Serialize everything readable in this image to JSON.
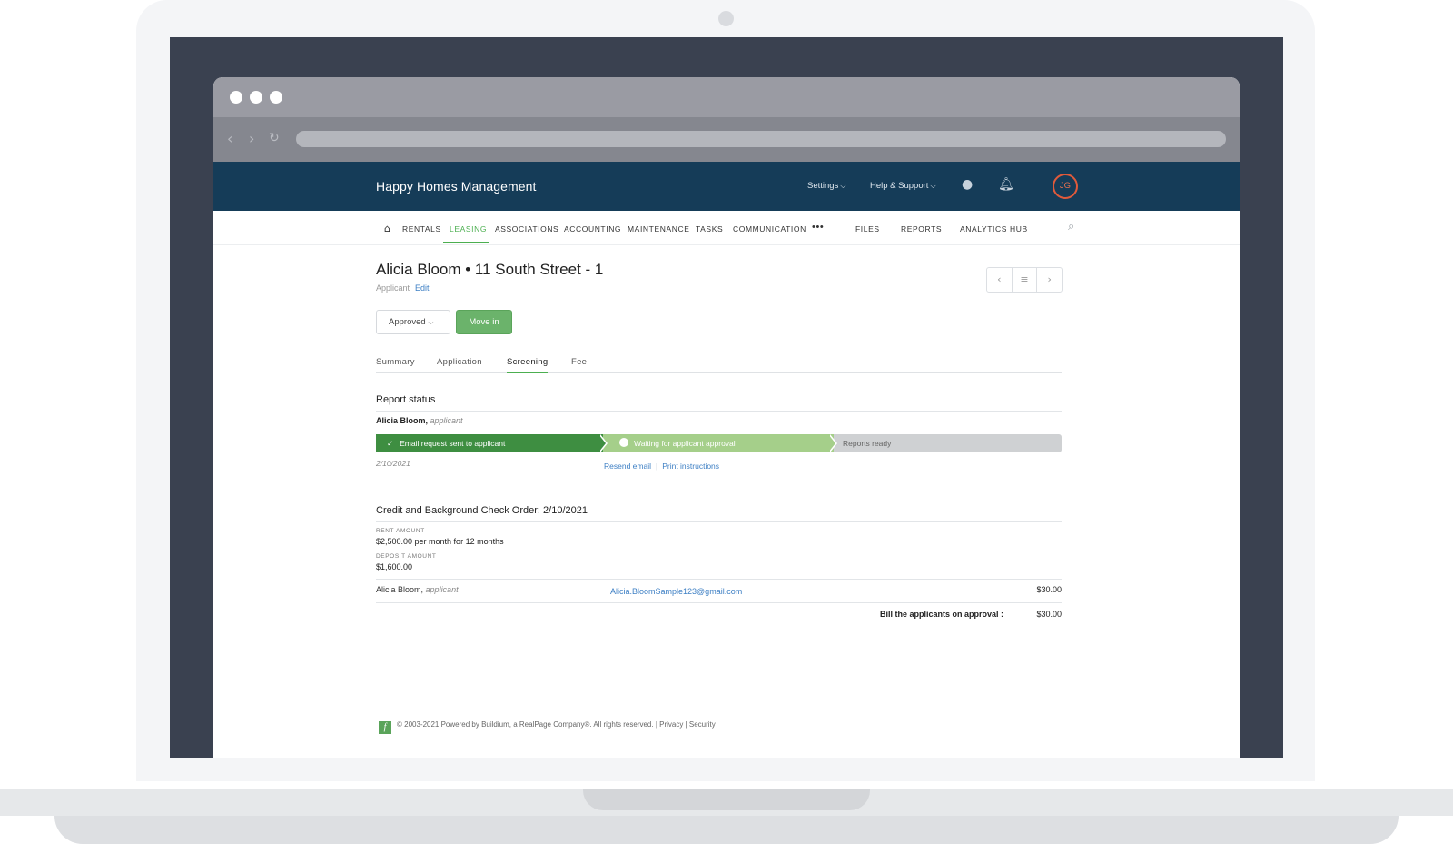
{
  "app": {
    "title": "Happy Homes Management"
  },
  "header": {
    "settings_label": "Settings",
    "help_label": "Help & Support",
    "avatar_initials": "JG",
    "icons": [
      "chat-icon",
      "bell-icon"
    ]
  },
  "nav": {
    "items": [
      "RENTALS",
      "LEASING",
      "ASSOCIATIONS",
      "ACCOUNTING",
      "MAINTENANCE",
      "TASKS",
      "COMMUNICATION",
      "•••",
      "FILES",
      "REPORTS",
      "ANALYTICS HUB"
    ],
    "active": "LEASING"
  },
  "page": {
    "title": "Alicia Bloom  •  11 South Street - 1",
    "role": "Applicant",
    "edit_label": "Edit"
  },
  "actions": {
    "status_label": "Approved",
    "move_in_label": "Move in"
  },
  "tabs": {
    "items": [
      "Summary",
      "Application",
      "Screening",
      "Fee"
    ],
    "active": "Screening"
  },
  "report_status": {
    "title": "Report status",
    "applicant_name": "Alicia Bloom,",
    "applicant_role": "applicant",
    "steps": [
      "Email request sent to applicant",
      "Waiting for applicant approval",
      "Reports ready"
    ],
    "current_step": 2,
    "date": "2/10/2021",
    "resend_label": "Resend email",
    "print_label": "Print instructions"
  },
  "order": {
    "title": "Credit and Background Check Order: 2/10/2021",
    "rent_label": "RENT AMOUNT",
    "rent_value": "$2,500.00 per month for 12 months",
    "deposit_label": "DEPOSIT AMOUNT",
    "deposit_value": "$1,600.00",
    "applicant_name": "Alicia Bloom,",
    "applicant_role": "applicant",
    "applicant_email": "Alicia.BloomSample123@gmail.com",
    "applicant_amount": "$30.00",
    "bill_label": "Bill the applicants on approval :",
    "bill_amount": "$30.00"
  },
  "footer": {
    "text": "© 2003-2021 Powered by Buildium, a RealPage Company®. All rights reserved.  |  Privacy  |  Security"
  },
  "colors": {
    "header_bg": "#153c58",
    "accent_green": "#4caf50",
    "step_done": "#3e8e41",
    "step_current": "#a5cf8a",
    "step_pending": "#cfd1d3",
    "link_blue": "#3d7fc4",
    "avatar_ring": "#e05a3b"
  }
}
